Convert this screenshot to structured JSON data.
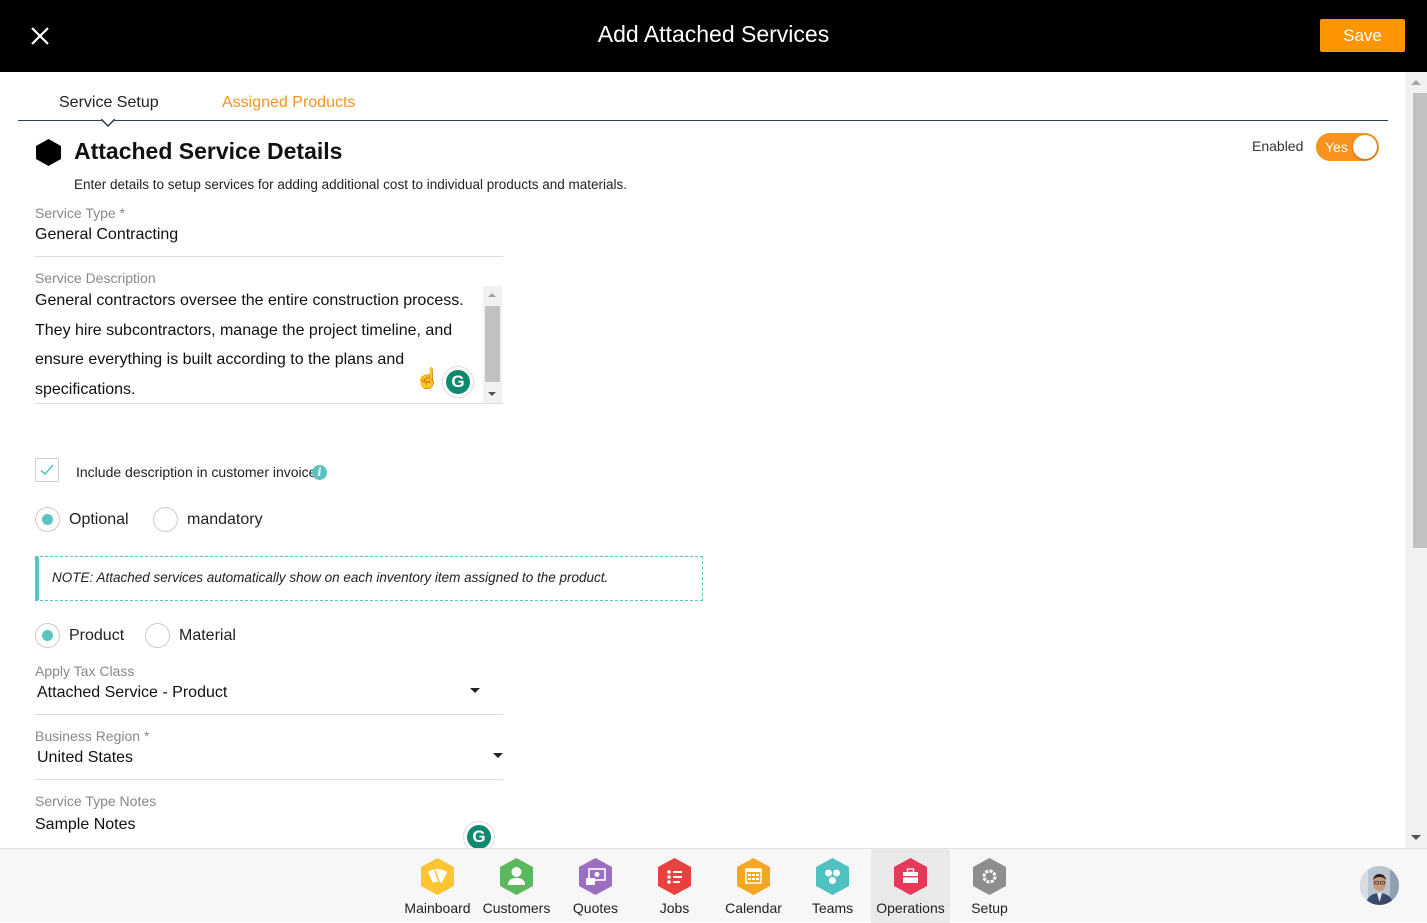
{
  "header": {
    "title": "Add Attached Services",
    "save_label": "Save",
    "close_icon": "close-icon"
  },
  "tabs": [
    {
      "label": "Service Setup",
      "active": true
    },
    {
      "label": "Assigned Products",
      "active": false
    }
  ],
  "section": {
    "title": "Attached Service Details",
    "subtitle": "Enter details to setup services for adding additional cost to individual products and materials.",
    "enabled_label": "Enabled",
    "toggle_text": "Yes",
    "enabled": true
  },
  "form": {
    "service_type": {
      "label": "Service Type *",
      "value": "General Contracting"
    },
    "service_description": {
      "label": "Service Description",
      "value": "General contractors oversee the entire construction process. They hire subcontractors, manage the project timeline, and ensure everything is built according to the plans and specifications."
    },
    "include_description": {
      "label": "Include description in customer invoice",
      "checked": true,
      "info_icon": "i"
    },
    "requirement": {
      "options": [
        "Optional",
        "mandatory"
      ],
      "selected": "Optional"
    },
    "note": "NOTE: Attached services automatically show on each inventory item assigned to the product.",
    "item_kind": {
      "options": [
        "Product",
        "Material"
      ],
      "selected": "Product"
    },
    "tax_class": {
      "label": "Apply Tax Class",
      "value": "Attached Service - Product"
    },
    "business_region": {
      "label": "Business Region *",
      "value": "United States"
    },
    "service_type_notes": {
      "label": "Service Type Notes",
      "value": "Sample Notes"
    }
  },
  "grammarly": {
    "glyph": "G"
  },
  "hand_emoji": "☝",
  "bottom_nav": {
    "items": [
      {
        "label": "Mainboard",
        "color": "#fdc52f",
        "icon": "mainboard-icon",
        "active": false
      },
      {
        "label": "Customers",
        "color": "#5cb85c",
        "icon": "customers-icon",
        "active": false
      },
      {
        "label": "Quotes",
        "color": "#9b6fc0",
        "icon": "quotes-icon",
        "active": false
      },
      {
        "label": "Jobs",
        "color": "#e9413d",
        "icon": "jobs-icon",
        "active": false
      },
      {
        "label": "Calendar",
        "color": "#f5a623",
        "icon": "calendar-icon",
        "active": false
      },
      {
        "label": "Teams",
        "color": "#4fc1c1",
        "icon": "teams-icon",
        "active": false
      },
      {
        "label": "Operations",
        "color": "#e7385a",
        "icon": "operations-icon",
        "active": true
      },
      {
        "label": "Setup",
        "color": "#8e8e8e",
        "icon": "setup-icon",
        "active": false
      }
    ]
  },
  "colors": {
    "accent": "#ff9500",
    "teal": "#5bc4c0",
    "header_bg": "#000000"
  }
}
